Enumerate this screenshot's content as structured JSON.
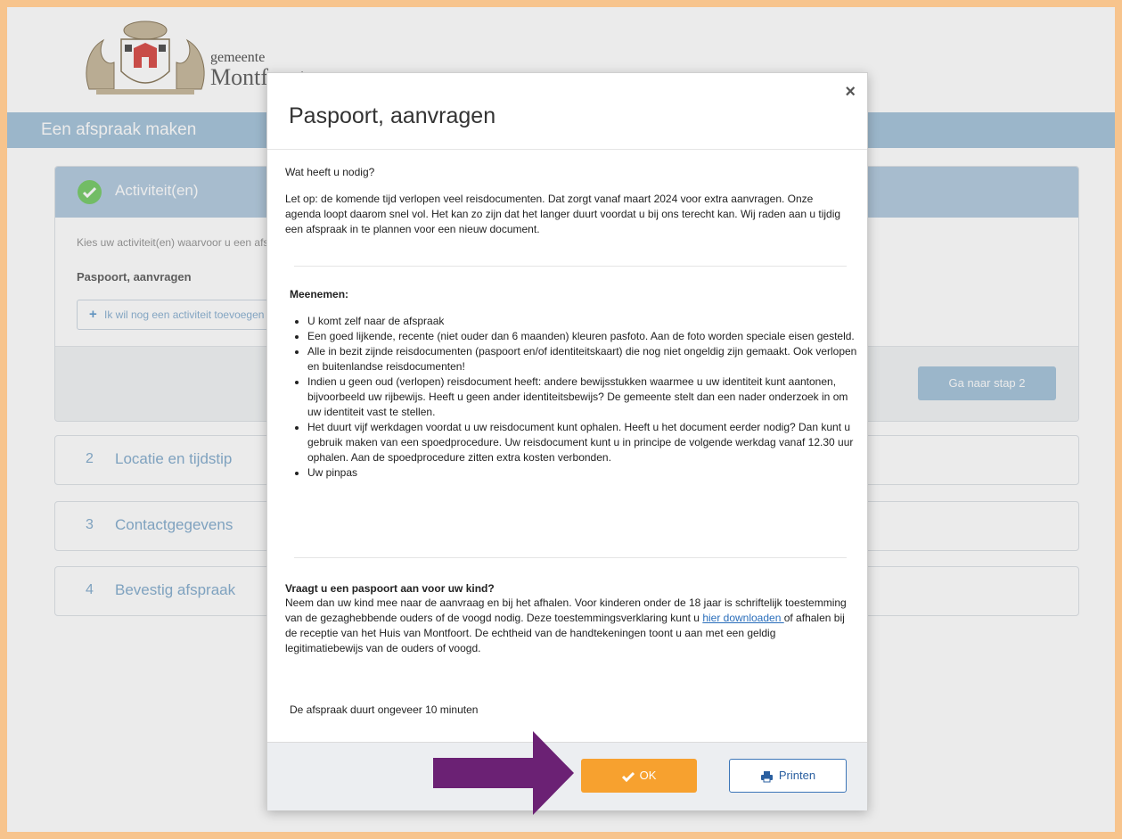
{
  "header": {
    "brand_small": "gemeente",
    "brand_big": "Montfoort",
    "title": "Een afspraak maken"
  },
  "step1": {
    "label": "Activiteit(en)",
    "instruction": "Kies uw activiteit(en) waarvoor u een afspraak wilt maken",
    "selected_activity": "Paspoort, aanvragen",
    "add_activity": "Ik wil nog een activiteit toevoegen",
    "next_button": "Ga naar stap 2"
  },
  "steps": [
    {
      "num": "2",
      "label": "Locatie en tijdstip"
    },
    {
      "num": "3",
      "label": "Contactgegevens"
    },
    {
      "num": "4",
      "label": "Bevestig afspraak"
    }
  ],
  "modal": {
    "title": "Paspoort, aanvragen",
    "close": "×",
    "question": "Wat heeft u nodig?",
    "note": "Let op: de komende tijd verlopen veel reisdocumenten. Dat zorgt vanaf maart 2024 voor extra aanvragen. Onze agenda loopt daarom snel vol. Het kan zo zijn dat het langer duurt voordat u bij ons terecht kan. Wij raden aan u tijdig een afspraak in te plannen voor een nieuw document.",
    "bring_heading": "Meenemen:",
    "bring_items": [
      "U komt zelf naar de afspraak",
      "Een goed lijkende, recente (niet ouder dan 6 maanden) kleuren pasfoto. Aan de foto worden speciale eisen gesteld.",
      "Alle in bezit zijnde reisdocumenten (paspoort en/of identiteitskaart) die nog niet ongeldig zijn gemaakt. Ook verlopen en buitenlandse reisdocumenten!",
      "Indien u geen oud (verlopen) reisdocument heeft: andere bewijsstukken waarmee u uw identiteit kunt aantonen, bijvoorbeeld uw rijbewijs. Heeft u geen ander identiteitsbewijs? De gemeente stelt dan een nader onderzoek in om uw identiteit vast te stellen.",
      "Het duurt vijf werkdagen voordat u uw reisdocument kunt ophalen. Heeft u het document eerder nodig? Dan kunt u gebruik maken van een spoedprocedure. Uw reisdocument kunt u in principe de volgende werkdag vanaf 12.30 uur ophalen. Aan de spoedprocedure zitten extra kosten verbonden.",
      "Uw pinpas"
    ],
    "child_heading": "Vraagt u een paspoort aan voor uw kind?",
    "child_text_before": "Neem dan uw kind mee naar de aanvraag en bij het afhalen. Voor kinderen onder de 18 jaar is schriftelijk toestemming van de gezaghebbende ouders of de voogd nodig. Deze toestemmingsverklaring kunt u ",
    "child_link": "hier downloaden ",
    "child_text_after": "of afhalen bij de receptie van het Huis van Montfoort. De echtheid van de handtekeningen toont u aan met een geldig legitimatiebewijs van de ouders of voogd.",
    "duration": "De afspraak duurt ongeveer 10 minuten",
    "ok_button": "OK",
    "print_button": "Printen"
  },
  "colors": {
    "frame": "#f7c48d",
    "titlebar": "#a9c6dc",
    "ok": "#f7a12f",
    "arrow": "#6b2174",
    "check": "#7ccc6e"
  }
}
